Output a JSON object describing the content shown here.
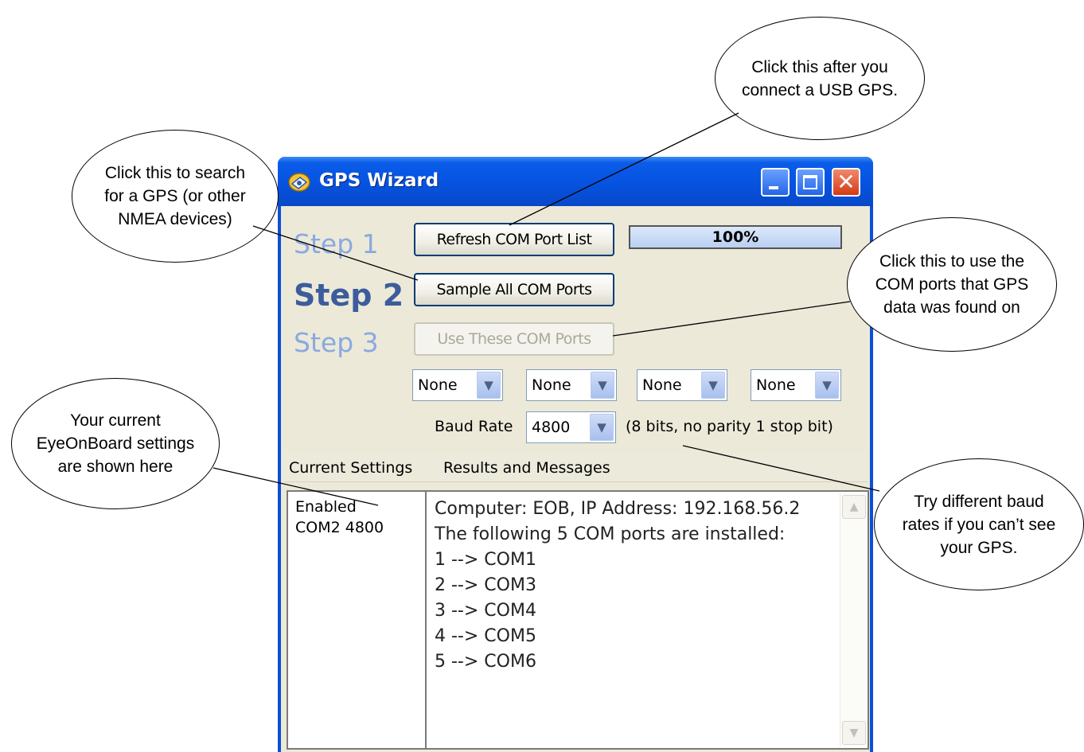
{
  "window": {
    "title": "GPS Wizard",
    "caption": {
      "close_glyph": "✕"
    }
  },
  "steps": {
    "step1_label": "Step 1",
    "step2_label": "Step 2",
    "step3_label": "Step 3"
  },
  "buttons": {
    "refresh": "Refresh COM Port List",
    "sample": "Sample All COM Ports",
    "use": "Use These COM Ports"
  },
  "progress": {
    "label": "100%",
    "value": 1.0
  },
  "ports": {
    "p1": "None",
    "p2": "None",
    "p3": "None",
    "p4": "None"
  },
  "baud": {
    "label": "Baud Rate",
    "value": "4800",
    "hint": "(8 bits, no parity 1 stop bit)"
  },
  "headers": {
    "current": "Current Settings",
    "results": "Results and Messages"
  },
  "current_settings": {
    "line1": "Enabled",
    "line2": "COM2 4800"
  },
  "messages": [
    "Computer: EOB, IP Address: 192.168.56.2",
    "The following 5 COM ports are installed:",
    "1 --> COM1",
    "2 --> COM3",
    "3 --> COM4",
    "4 --> COM5",
    "5 --> COM6"
  ],
  "callouts": {
    "usb": "Click this after you\nconnect a USB GPS.",
    "search": "Click this to search\nfor  a GPS (or other\nNMEA devices)",
    "use_ports": "Click this to use the\nCOM ports that GPS\ndata was found on",
    "settings": "Your current\nEyeOnBoard settings\nare shown here",
    "baud": "Try different baud\nrates if you can’t see\nyour GPS."
  },
  "colors": {
    "titlebar": "#0653e0",
    "window_bg": "#ece9d8",
    "step_active": "#3c5c9c",
    "step_inactive": "#8aa9e0"
  },
  "icons": {
    "app": "satellite-icon",
    "dropdown": "chevron-down-icon",
    "scroll_up": "scroll-up-icon",
    "scroll_down": "scroll-down-icon"
  }
}
